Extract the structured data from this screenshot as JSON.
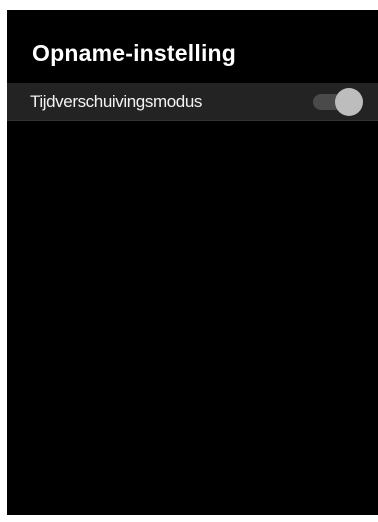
{
  "header": {
    "title": "Opname-instelling"
  },
  "settings": {
    "items": [
      {
        "label": "Tijdverschuivingsmodus",
        "control": "toggle",
        "state": "on"
      }
    ]
  },
  "colors": {
    "background": "#000000",
    "row_background": "#232323",
    "toggle_track": "#4a4a4a",
    "toggle_knob": "#bdbdbd",
    "text": "#ffffff"
  }
}
